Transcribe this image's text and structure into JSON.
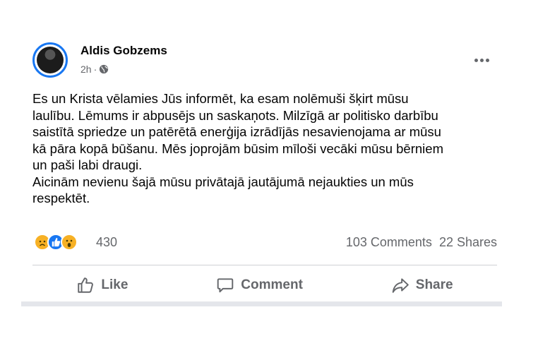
{
  "post": {
    "author": "Aldis Gobzems",
    "time": "2h",
    "separator": "·",
    "text": "Es un Krista vēlamies Jūs informēt, ka esam nolēmuši šķirt mūsu\nlaulību. Lēmums ir abpusējs un saskaņots. Milzīgā ar politisko darbību\nsaistītā spriedze un patērētā enerģija izrādījās nesavienojama ar mūsu\nkā pāra kopā būšanu. Mēs joprojām būsim mīloši vecāki mūsu bērniem\nun paši labi draugi.\nAicinām nevienu šajā mūsu privātajā jautājumā nejaukties un mūs\nrespektēt."
  },
  "reactions": {
    "icons": [
      "sad",
      "like",
      "wow"
    ],
    "count": "430",
    "comments": "103 Comments",
    "shares": "22 Shares"
  },
  "actions": {
    "like": "Like",
    "comment": "Comment",
    "share": "Share"
  },
  "colors": {
    "accent": "#1877f2",
    "secondary_text": "#65676b",
    "divider": "#ced0d4"
  }
}
